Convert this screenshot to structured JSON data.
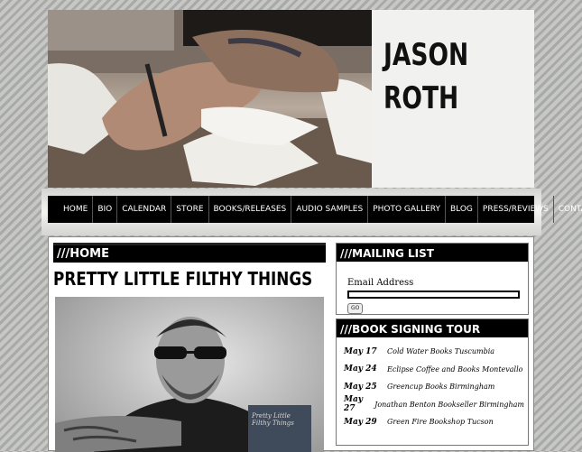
{
  "header": {
    "name_line1": "JASON",
    "name_line2": "ROTH"
  },
  "nav": [
    "HOME",
    "BIO",
    "CALENDAR",
    "STORE",
    "BOOKS/RELEASES",
    "AUDIO SAMPLES",
    "PHOTO GALLERY",
    "BLOG",
    "PRESS/REVIEWS",
    "CONTACT"
  ],
  "main": {
    "heading": "///HOME",
    "post_title": "PRETTY LITTLE FILTHY THINGS",
    "book_cover_text": "Pretty Little Filthy Things"
  },
  "mailing": {
    "heading": "///MAILING LIST",
    "label": "Email Address",
    "button": "GO"
  },
  "tour": {
    "heading": "///BOOK SIGNING TOUR",
    "events": [
      {
        "date": "May 17",
        "venue": "Cold Water Books Tuscumbia"
      },
      {
        "date": "May 24",
        "venue": "Eclipse Coffee and Books Montevallo"
      },
      {
        "date": "May 25",
        "venue": "Greencup Books Birmingham"
      },
      {
        "date": "May 27",
        "venue": "Jonathan Benton Bookseller Birmingham"
      },
      {
        "date": "May 29",
        "venue": "Green Fire Bookshop Tucson"
      }
    ]
  },
  "colors": {
    "nav_bg": "#000000",
    "panel_head": "#000000",
    "page_bg": "#b8b9b6"
  }
}
